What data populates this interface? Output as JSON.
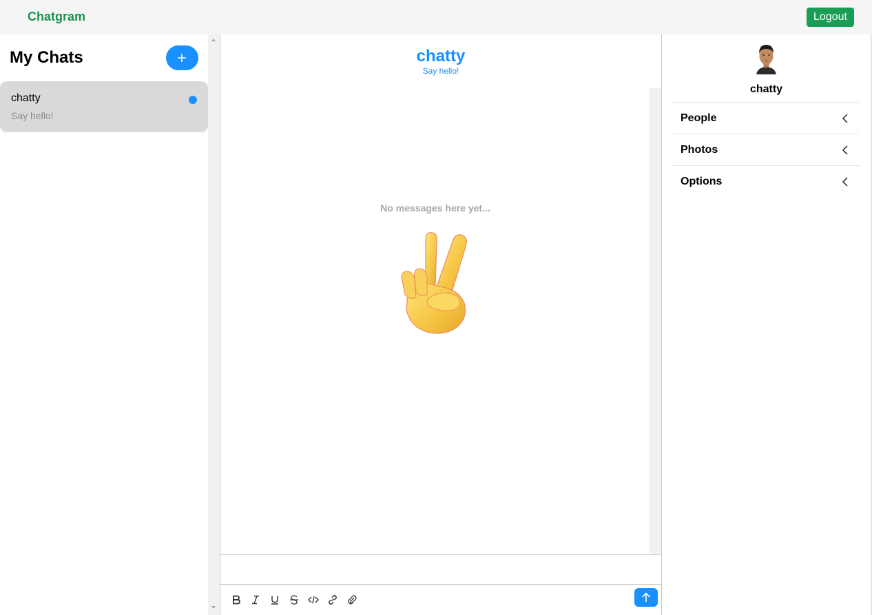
{
  "app": {
    "brand": "Chatgram",
    "logout_label": "Logout"
  },
  "sidebar": {
    "title": "My Chats",
    "new_chat_icon": "plus-icon",
    "chats": [
      {
        "title": "chatty",
        "subtitle": "Say hello!",
        "unread": true
      }
    ]
  },
  "chat": {
    "title": "chatty",
    "subtitle": "Say hello!",
    "empty_message": "No messages here yet...",
    "empty_emoji": "victory-hand-emoji",
    "toolbar": [
      "bold-icon",
      "italic-icon",
      "underline-icon",
      "strikethrough-icon",
      "code-icon",
      "link-icon",
      "attachment-icon"
    ],
    "send_icon": "arrow-up-icon"
  },
  "details": {
    "name": "chatty",
    "sections": [
      "People",
      "Photos",
      "Options"
    ]
  },
  "colors": {
    "brand_green": "#1a9450",
    "accent_blue": "#1890ff",
    "logout_green": "#1a9e55",
    "selected_chat": "#d9d9d9"
  }
}
